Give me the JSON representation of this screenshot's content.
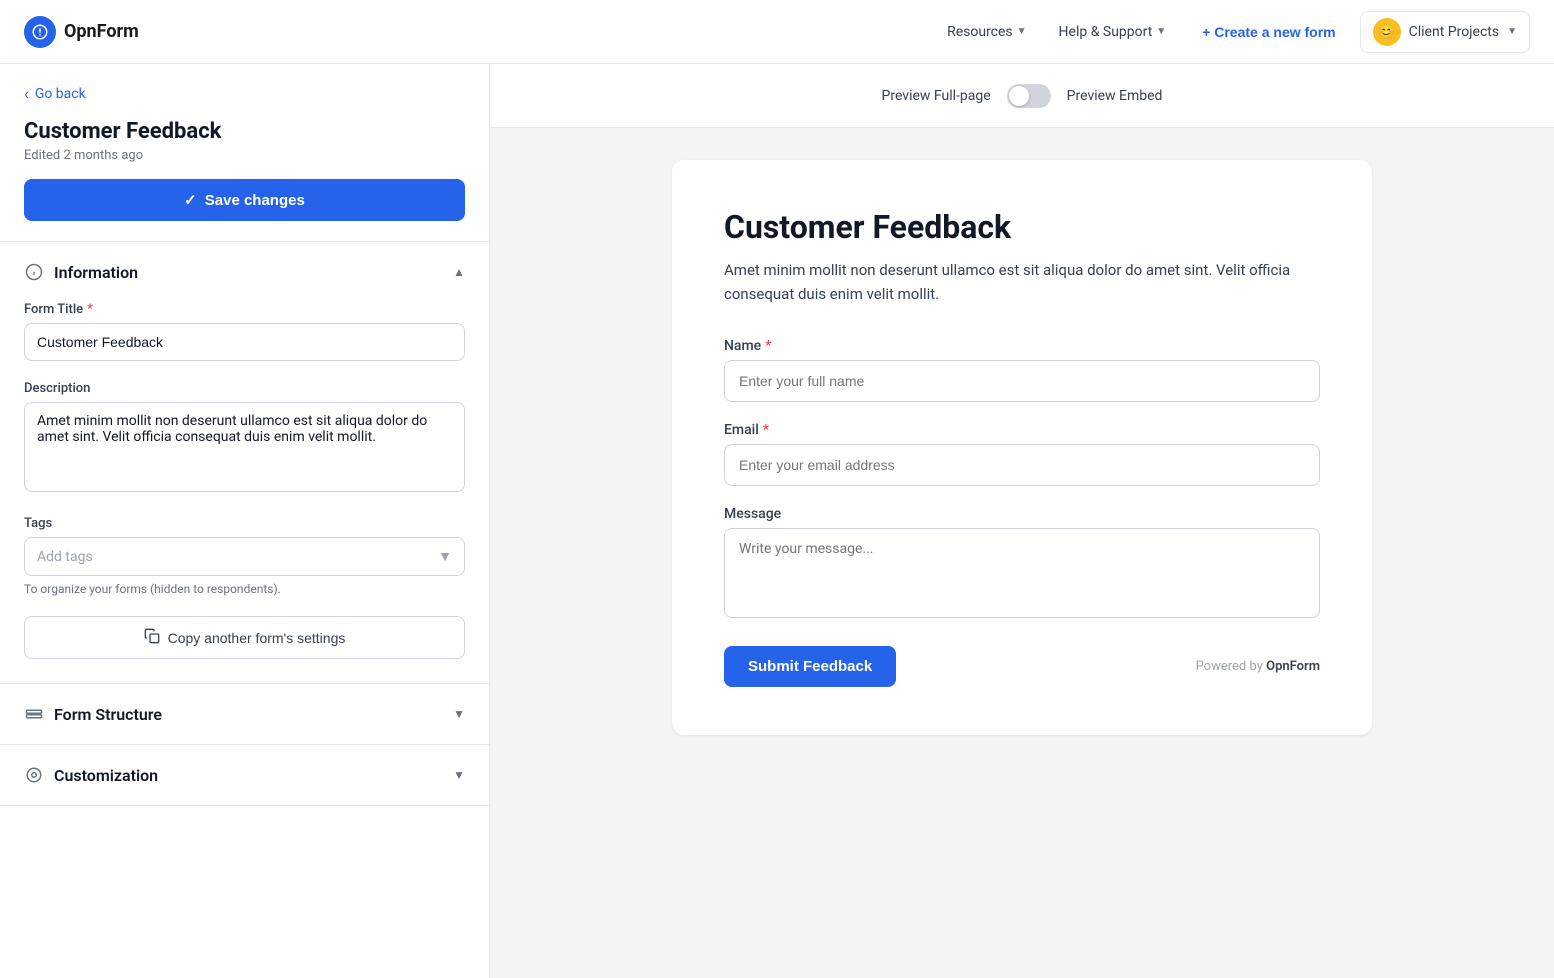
{
  "header": {
    "logo_text": "OpnForm",
    "nav": [
      {
        "label": "Resources",
        "has_chevron": true
      },
      {
        "label": "Help & Support",
        "has_chevron": true
      }
    ],
    "create_btn": "+ Create a new form",
    "workspace": {
      "emoji": "😊",
      "label": "Client Projects",
      "has_chevron": true
    }
  },
  "sidebar": {
    "go_back": "Go back",
    "form_title_display": "Customer Feedback",
    "form_subtitle": "Edited 2 months ago",
    "save_btn": "Save changes",
    "sections": {
      "information": {
        "label": "Information",
        "collapsed": false,
        "form_title_label": "Form Title",
        "form_title_value": "Customer Feedback",
        "form_title_placeholder": "Customer Feedback",
        "description_label": "Description",
        "description_value": "Amet minim mollit non deserunt ullamco est sit aliqua dolor do amet sint. Velit officia consequat duis enim velit mollit.",
        "tags_label": "Tags",
        "tags_placeholder": "Add tags",
        "tags_hint": "To organize your forms (hidden to respondents).",
        "copy_btn": "Copy another form's settings"
      },
      "form_structure": {
        "label": "Form Structure",
        "collapsed": true
      },
      "customization": {
        "label": "Customization",
        "collapsed": true
      }
    }
  },
  "preview": {
    "full_page_label": "Preview Full-page",
    "embed_label": "Preview Embed",
    "toggle_active": false
  },
  "form_preview": {
    "title": "Customer Feedback",
    "description": "Amet minim mollit non deserunt ullamco est sit aliqua dolor do amet sint. Velit officia consequat duis enim velit mollit.",
    "fields": [
      {
        "label": "Name",
        "required": true,
        "type": "text",
        "placeholder": "Enter your full name"
      },
      {
        "label": "Email",
        "required": true,
        "type": "text",
        "placeholder": "Enter your email address"
      },
      {
        "label": "Message",
        "required": false,
        "type": "textarea",
        "placeholder": "Write your message..."
      }
    ],
    "submit_label": "Submit Feedback",
    "powered_by_text": "Powered by ",
    "powered_by_brand": "OpnForm"
  },
  "icons": {
    "info": "ℹ",
    "form_structure": "⊟",
    "customization": "◎",
    "check": "✓",
    "copy": "⧉"
  }
}
